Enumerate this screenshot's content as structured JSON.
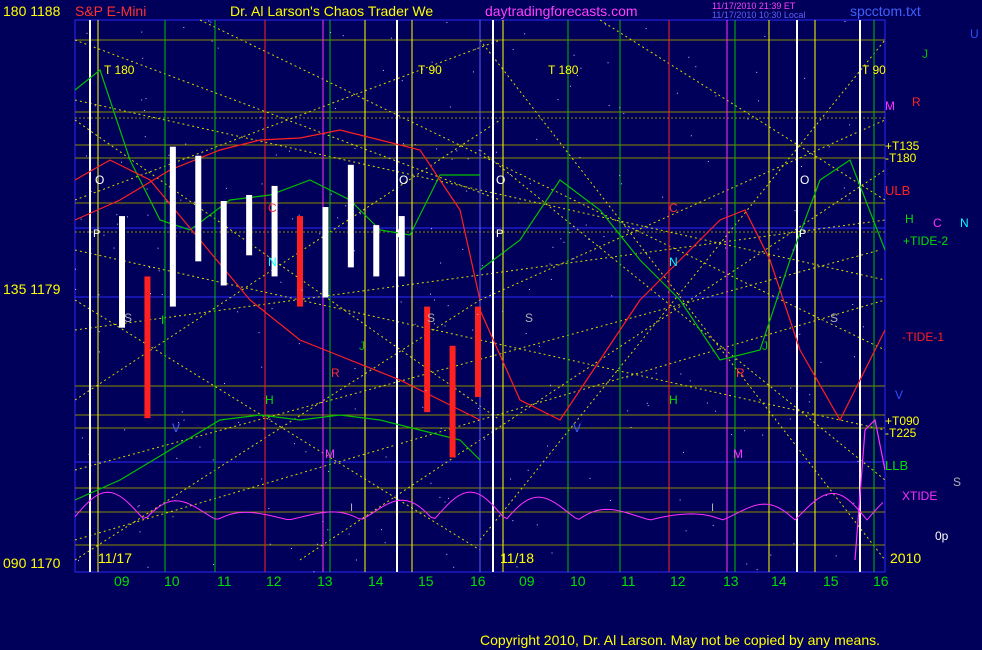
{
  "header": {
    "instrument_label": "S&P E-Mini",
    "title": "Dr. Al Larson's Chaos Trader We",
    "site": "daytradingforecasts.com",
    "timestamp_1": "11/17/2010 21:39 ET",
    "timestamp_2": "11/17/2010 10:30 Local",
    "file": "spcctom.txt"
  },
  "footer": {
    "copyright": "Copyright 2010, Dr. Al Larson. May not be copied by any means."
  },
  "y_axis": {
    "top": "180  1188",
    "mid": "135  1179",
    "bottom": "090  1170"
  },
  "x_axis": {
    "date_left": "11/17",
    "date_right": "11/18",
    "year": "2010",
    "ticks": [
      "09",
      "10",
      "11",
      "12",
      "13",
      "14",
      "15",
      "16",
      "09",
      "10",
      "11",
      "12",
      "13",
      "14",
      "15",
      "16"
    ]
  },
  "right_labels": {
    "U": "U",
    "J": "J",
    "M": "M",
    "R": "R",
    "T135": "+T135",
    "T180": "-T180",
    "ULB": "ULB",
    "H": "H",
    "C": "C",
    "N": "N",
    "TIDE2": "+TIDE-2",
    "TIDE1": "-TIDE-1",
    "V": "V",
    "T090": "+T090",
    "T225": "-T225",
    "LLB": "LLB",
    "S": "S",
    "XTIDE": "XTIDE",
    "Op": "0p"
  },
  "markers": {
    "t180_a": "T  180",
    "t90_a": "T  90",
    "t180_b": "T  180",
    "t90_b": "T  90",
    "O": "O",
    "P": "P",
    "S": "S",
    "C": "C",
    "N": "N",
    "H": "H",
    "V": "V",
    "M": "M",
    "R": "R",
    "J": "J",
    "I": "I"
  },
  "colors": {
    "background": "#00005a",
    "axis_text": "#ffff00",
    "red": "#ff2020",
    "green": "#00d000",
    "magenta": "#ff30ff",
    "cyan": "#00ffff",
    "white": "#ffffff",
    "grid_yellow": "#c8c800"
  },
  "chart_data": {
    "type": "line",
    "title": "S&P E-Mini",
    "y_range": [
      1170,
      1188
    ],
    "y_ticks": [
      1170,
      1179,
      1188
    ],
    "y_tick_degrees": [
      "090",
      "135",
      "180"
    ],
    "x_dates": [
      "11/17",
      "11/18"
    ],
    "x_hours": [
      "09",
      "10",
      "11",
      "12",
      "13",
      "14",
      "15",
      "16",
      "09",
      "10",
      "11",
      "12",
      "13",
      "14",
      "15",
      "16"
    ],
    "price_bars_approx": [
      {
        "hour": 9.0,
        "high": 1181.5,
        "low": 1177.8
      },
      {
        "hour": 9.5,
        "high": 1179.5,
        "low": 1174.8
      },
      {
        "hour": 10.0,
        "high": 1183.8,
        "low": 1178.5
      },
      {
        "hour": 10.5,
        "high": 1183.5,
        "low": 1180.0
      },
      {
        "hour": 11.0,
        "high": 1182.0,
        "low": 1179.2
      },
      {
        "hour": 11.5,
        "high": 1182.2,
        "low": 1180.2
      },
      {
        "hour": 12.0,
        "high": 1182.5,
        "low": 1179.5
      },
      {
        "hour": 12.5,
        "high": 1181.5,
        "low": 1178.5
      },
      {
        "hour": 13.0,
        "high": 1181.8,
        "low": 1178.8
      },
      {
        "hour": 13.5,
        "high": 1183.2,
        "low": 1179.8
      },
      {
        "hour": 14.0,
        "high": 1181.2,
        "low": 1179.5
      },
      {
        "hour": 14.5,
        "high": 1181.5,
        "low": 1179.5
      },
      {
        "hour": 15.0,
        "high": 1178.5,
        "low": 1175.0
      },
      {
        "hour": 15.5,
        "high": 1177.2,
        "low": 1173.5
      },
      {
        "hour": 16.0,
        "high": 1178.5,
        "low": 1175.5
      }
    ],
    "annotations": [
      "+T135",
      "-T180",
      "ULB",
      "+TIDE-2",
      "-TIDE-1",
      "+T090",
      "-T225",
      "LLB",
      "XTIDE"
    ]
  }
}
